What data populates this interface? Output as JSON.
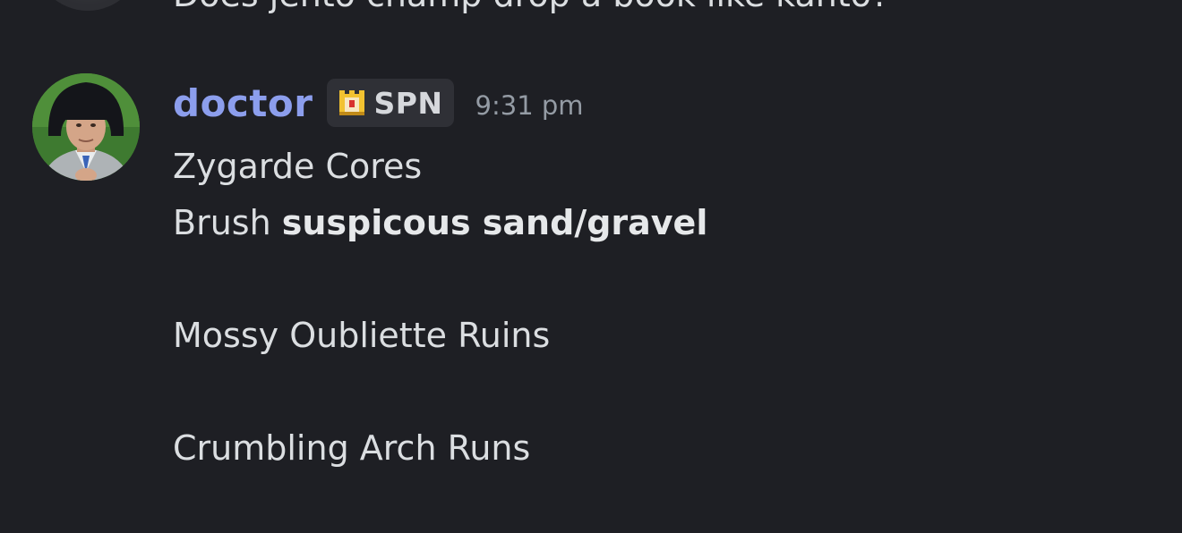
{
  "previous_message": {
    "text": "Does jento champ drop a book like kanto?"
  },
  "message": {
    "author": {
      "username": "doctor",
      "username_color": "#8c9eed",
      "avatar_icon": "user-avatar"
    },
    "tag": {
      "icon": "castle-badge-icon",
      "label": "SPN"
    },
    "timestamp": "9:31 pm",
    "lines": {
      "line1": "Zygarde Cores",
      "line2_prefix": "Brush ",
      "line2_bold": "suspicous sand/gravel",
      "line3": "",
      "line4": "Mossy Oubliette Ruins",
      "line5": "",
      "line6": "Crumbling Arch Runs"
    }
  },
  "colors": {
    "background": "#1e1f24",
    "text": "#dbdee1",
    "timestamp": "#949ba4",
    "tag_bg": "#2f3036"
  }
}
